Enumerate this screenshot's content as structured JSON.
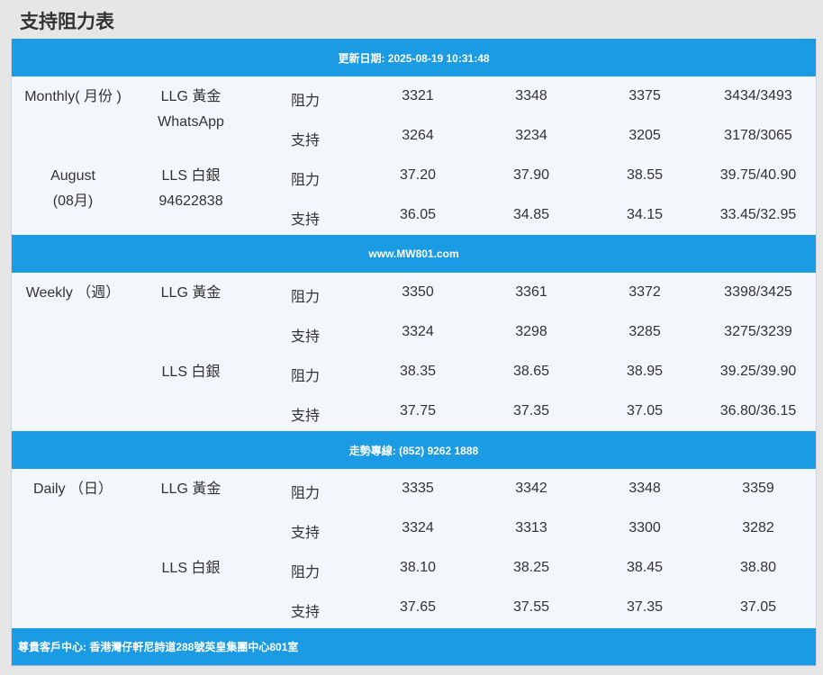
{
  "page_title": "支持阻力表",
  "header_band": "更新日期: 2025-08-19 10:31:48",
  "band_2": "www.MW801.com",
  "band_3": "走勢專線: (852) 9262 1888",
  "footer_band": "尊貴客戶中心: 香港灣仔軒尼詩道288號英皇集團中心801室",
  "sections": [
    {
      "period_a": "Monthly( 月份 )",
      "period_b_1": "August",
      "period_b_2": "(08月)",
      "gold_label": "LLG 黃金",
      "gold_note": "WhatsApp",
      "silver_label": "LLS 白銀",
      "silver_note": "94622838",
      "rows": [
        {
          "kind": "阻力",
          "values": [
            "3321",
            "3348",
            "3375",
            "3434/3493"
          ]
        },
        {
          "kind": "支持",
          "values": [
            "3264",
            "3234",
            "3205",
            "3178/3065"
          ]
        },
        {
          "kind": "阻力",
          "values": [
            "37.20",
            "37.90",
            "38.55",
            "39.75/40.90"
          ]
        },
        {
          "kind": "支持",
          "values": [
            "36.05",
            "34.85",
            "34.15",
            "33.45/32.95"
          ]
        }
      ]
    },
    {
      "period_a": "Weekly （週）",
      "gold_label": "LLG 黃金",
      "silver_label": "LLS 白銀",
      "rows": [
        {
          "kind": "阻力",
          "values": [
            "3350",
            "3361",
            "3372",
            "3398/3425"
          ]
        },
        {
          "kind": "支持",
          "values": [
            "3324",
            "3298",
            "3285",
            "3275/3239"
          ]
        },
        {
          "kind": "阻力",
          "values": [
            "38.35",
            "38.65",
            "38.95",
            "39.25/39.90"
          ]
        },
        {
          "kind": "支持",
          "values": [
            "37.75",
            "37.35",
            "37.05",
            "36.80/36.15"
          ]
        }
      ]
    },
    {
      "period_a": "Daily （日）",
      "gold_label": "LLG 黃金",
      "silver_label": "LLS 白銀",
      "rows": [
        {
          "kind": "阻力",
          "values": [
            "3335",
            "3342",
            "3348",
            "3359"
          ]
        },
        {
          "kind": "支持",
          "values": [
            "3324",
            "3313",
            "3300",
            "3282"
          ]
        },
        {
          "kind": "阻力",
          "values": [
            "38.10",
            "38.25",
            "38.45",
            "38.80"
          ]
        },
        {
          "kind": "支持",
          "values": [
            "37.65",
            "37.55",
            "37.35",
            "37.05"
          ]
        }
      ]
    }
  ]
}
